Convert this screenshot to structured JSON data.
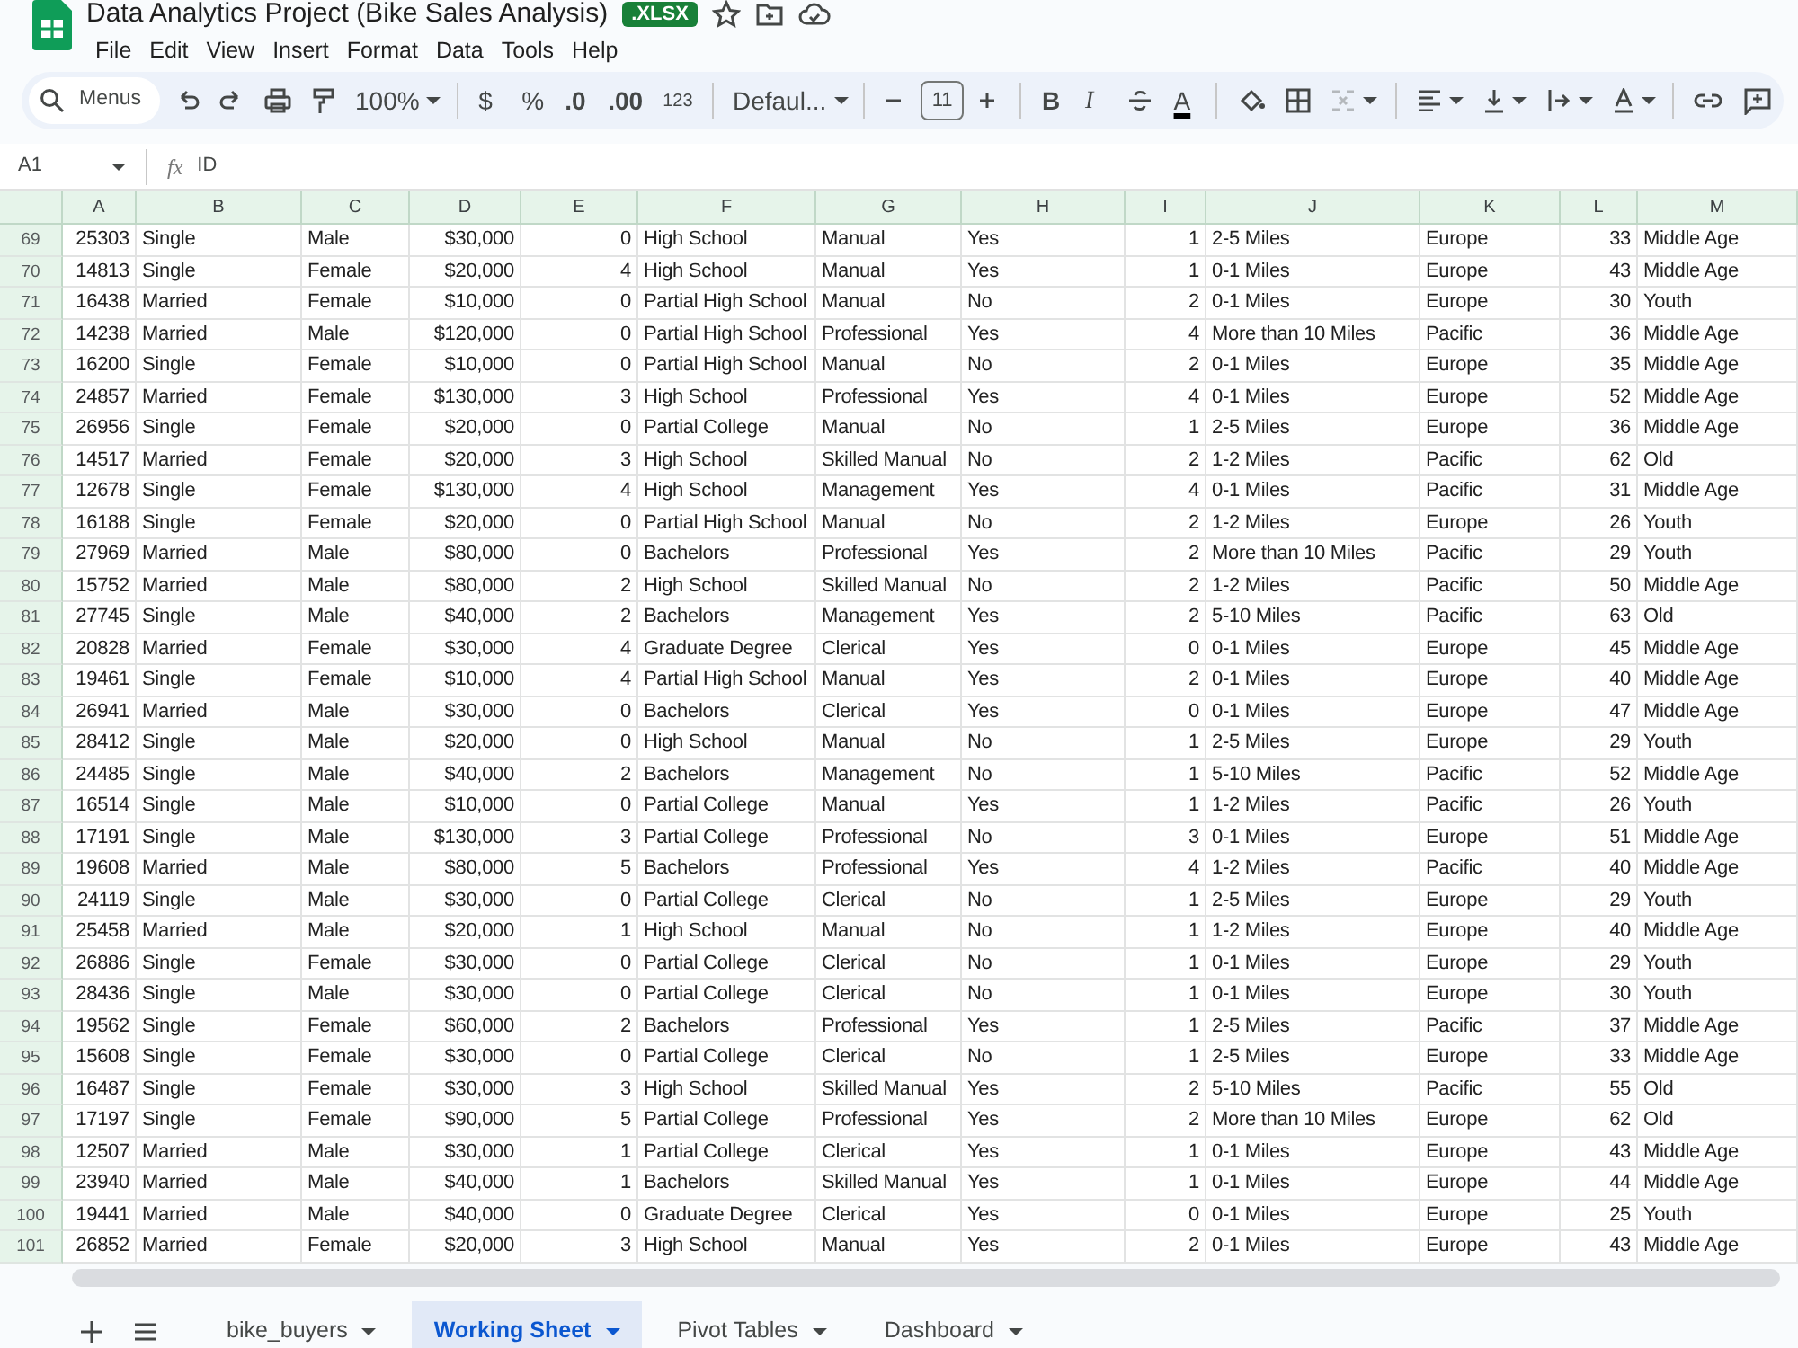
{
  "app": {
    "title": "Data Analytics Project (Bike Sales Analysis)",
    "badge": ".XLSX",
    "menu": [
      "File",
      "Edit",
      "View",
      "Insert",
      "Format",
      "Data",
      "Tools",
      "Help"
    ]
  },
  "toolbar": {
    "search_placeholder": "Menus",
    "zoom": "100%",
    "currency": "$",
    "percent": "%",
    "decimal_decrease": ".0",
    "decimal_increase": ".00",
    "number_format": "123",
    "font": "Defaul...",
    "font_size": "11",
    "bold": "B",
    "italic": "I",
    "text_color": "A"
  },
  "formula_bar": {
    "cell": "A1",
    "fx": "fx",
    "value": "ID"
  },
  "columns": [
    {
      "label": "A",
      "kind": "number"
    },
    {
      "label": "B",
      "kind": "text"
    },
    {
      "label": "C",
      "kind": "text"
    },
    {
      "label": "D",
      "kind": "number"
    },
    {
      "label": "E",
      "kind": "number"
    },
    {
      "label": "F",
      "kind": "text"
    },
    {
      "label": "G",
      "kind": "text"
    },
    {
      "label": "H",
      "kind": "text"
    },
    {
      "label": "I",
      "kind": "number"
    },
    {
      "label": "J",
      "kind": "text"
    },
    {
      "label": "K",
      "kind": "text"
    },
    {
      "label": "L",
      "kind": "number"
    },
    {
      "label": "M",
      "kind": "text"
    }
  ],
  "rows": [
    {
      "n": "69",
      "cells": [
        "25303",
        "Single",
        "Male",
        "$30,000",
        "0",
        "High School",
        "Manual",
        "Yes",
        "1",
        "2-5 Miles",
        "Europe",
        "33",
        "Middle Age"
      ]
    },
    {
      "n": "70",
      "cells": [
        "14813",
        "Single",
        "Female",
        "$20,000",
        "4",
        "High School",
        "Manual",
        "Yes",
        "1",
        "0-1 Miles",
        "Europe",
        "43",
        "Middle Age"
      ]
    },
    {
      "n": "71",
      "cells": [
        "16438",
        "Married",
        "Female",
        "$10,000",
        "0",
        "Partial High School",
        "Manual",
        "No",
        "2",
        "0-1 Miles",
        "Europe",
        "30",
        "Youth"
      ]
    },
    {
      "n": "72",
      "cells": [
        "14238",
        "Married",
        "Male",
        "$120,000",
        "0",
        "Partial High School",
        "Professional",
        "Yes",
        "4",
        "More than 10 Miles",
        "Pacific",
        "36",
        "Middle Age"
      ]
    },
    {
      "n": "73",
      "cells": [
        "16200",
        "Single",
        "Female",
        "$10,000",
        "0",
        "Partial High School",
        "Manual",
        "No",
        "2",
        "0-1 Miles",
        "Europe",
        "35",
        "Middle Age"
      ]
    },
    {
      "n": "74",
      "cells": [
        "24857",
        "Married",
        "Female",
        "$130,000",
        "3",
        "High School",
        "Professional",
        "Yes",
        "4",
        "0-1 Miles",
        "Europe",
        "52",
        "Middle Age"
      ]
    },
    {
      "n": "75",
      "cells": [
        "26956",
        "Single",
        "Female",
        "$20,000",
        "0",
        "Partial College",
        "Manual",
        "No",
        "1",
        "2-5 Miles",
        "Europe",
        "36",
        "Middle Age"
      ]
    },
    {
      "n": "76",
      "cells": [
        "14517",
        "Married",
        "Female",
        "$20,000",
        "3",
        "High School",
        "Skilled Manual",
        "No",
        "2",
        "1-2 Miles",
        "Pacific",
        "62",
        "Old"
      ]
    },
    {
      "n": "77",
      "cells": [
        "12678",
        "Single",
        "Female",
        "$130,000",
        "4",
        "High School",
        "Management",
        "Yes",
        "4",
        "0-1 Miles",
        "Pacific",
        "31",
        "Middle Age"
      ]
    },
    {
      "n": "78",
      "cells": [
        "16188",
        "Single",
        "Female",
        "$20,000",
        "0",
        "Partial High School",
        "Manual",
        "No",
        "2",
        "1-2 Miles",
        "Europe",
        "26",
        "Youth"
      ]
    },
    {
      "n": "79",
      "cells": [
        "27969",
        "Married",
        "Male",
        "$80,000",
        "0",
        "Bachelors",
        "Professional",
        "Yes",
        "2",
        "More than 10 Miles",
        "Pacific",
        "29",
        "Youth"
      ]
    },
    {
      "n": "80",
      "cells": [
        "15752",
        "Married",
        "Male",
        "$80,000",
        "2",
        "High School",
        "Skilled Manual",
        "No",
        "2",
        "1-2 Miles",
        "Pacific",
        "50",
        "Middle Age"
      ]
    },
    {
      "n": "81",
      "cells": [
        "27745",
        "Single",
        "Male",
        "$40,000",
        "2",
        "Bachelors",
        "Management",
        "Yes",
        "2",
        "5-10 Miles",
        "Pacific",
        "63",
        "Old"
      ]
    },
    {
      "n": "82",
      "cells": [
        "20828",
        "Married",
        "Female",
        "$30,000",
        "4",
        "Graduate Degree",
        "Clerical",
        "Yes",
        "0",
        "0-1 Miles",
        "Europe",
        "45",
        "Middle Age"
      ]
    },
    {
      "n": "83",
      "cells": [
        "19461",
        "Single",
        "Female",
        "$10,000",
        "4",
        "Partial High School",
        "Manual",
        "Yes",
        "2",
        "0-1 Miles",
        "Europe",
        "40",
        "Middle Age"
      ]
    },
    {
      "n": "84",
      "cells": [
        "26941",
        "Married",
        "Male",
        "$30,000",
        "0",
        "Bachelors",
        "Clerical",
        "Yes",
        "0",
        "0-1 Miles",
        "Europe",
        "47",
        "Middle Age"
      ]
    },
    {
      "n": "85",
      "cells": [
        "28412",
        "Single",
        "Male",
        "$20,000",
        "0",
        "High School",
        "Manual",
        "No",
        "1",
        "2-5 Miles",
        "Europe",
        "29",
        "Youth"
      ]
    },
    {
      "n": "86",
      "cells": [
        "24485",
        "Single",
        "Male",
        "$40,000",
        "2",
        "Bachelors",
        "Management",
        "No",
        "1",
        "5-10 Miles",
        "Pacific",
        "52",
        "Middle Age"
      ]
    },
    {
      "n": "87",
      "cells": [
        "16514",
        "Single",
        "Male",
        "$10,000",
        "0",
        "Partial College",
        "Manual",
        "Yes",
        "1",
        "1-2 Miles",
        "Pacific",
        "26",
        "Youth"
      ]
    },
    {
      "n": "88",
      "cells": [
        "17191",
        "Single",
        "Male",
        "$130,000",
        "3",
        "Partial College",
        "Professional",
        "No",
        "3",
        "0-1 Miles",
        "Europe",
        "51",
        "Middle Age"
      ]
    },
    {
      "n": "89",
      "cells": [
        "19608",
        "Married",
        "Male",
        "$80,000",
        "5",
        "Bachelors",
        "Professional",
        "Yes",
        "4",
        "1-2 Miles",
        "Pacific",
        "40",
        "Middle Age"
      ]
    },
    {
      "n": "90",
      "cells": [
        "24119",
        "Single",
        "Male",
        "$30,000",
        "0",
        "Partial College",
        "Clerical",
        "No",
        "1",
        "2-5 Miles",
        "Europe",
        "29",
        "Youth"
      ]
    },
    {
      "n": "91",
      "cells": [
        "25458",
        "Married",
        "Male",
        "$20,000",
        "1",
        "High School",
        "Manual",
        "No",
        "1",
        "1-2 Miles",
        "Europe",
        "40",
        "Middle Age"
      ]
    },
    {
      "n": "92",
      "cells": [
        "26886",
        "Single",
        "Female",
        "$30,000",
        "0",
        "Partial College",
        "Clerical",
        "No",
        "1",
        "0-1 Miles",
        "Europe",
        "29",
        "Youth"
      ]
    },
    {
      "n": "93",
      "cells": [
        "28436",
        "Single",
        "Male",
        "$30,000",
        "0",
        "Partial College",
        "Clerical",
        "No",
        "1",
        "0-1 Miles",
        "Europe",
        "30",
        "Youth"
      ]
    },
    {
      "n": "94",
      "cells": [
        "19562",
        "Single",
        "Female",
        "$60,000",
        "2",
        "Bachelors",
        "Professional",
        "Yes",
        "1",
        "2-5 Miles",
        "Pacific",
        "37",
        "Middle Age"
      ]
    },
    {
      "n": "95",
      "cells": [
        "15608",
        "Single",
        "Female",
        "$30,000",
        "0",
        "Partial College",
        "Clerical",
        "No",
        "1",
        "2-5 Miles",
        "Europe",
        "33",
        "Middle Age"
      ]
    },
    {
      "n": "96",
      "cells": [
        "16487",
        "Single",
        "Female",
        "$30,000",
        "3",
        "High School",
        "Skilled Manual",
        "Yes",
        "2",
        "5-10 Miles",
        "Pacific",
        "55",
        "Old"
      ]
    },
    {
      "n": "97",
      "cells": [
        "17197",
        "Single",
        "Female",
        "$90,000",
        "5",
        "Partial College",
        "Professional",
        "Yes",
        "2",
        "More than 10 Miles",
        "Europe",
        "62",
        "Old"
      ]
    },
    {
      "n": "98",
      "cells": [
        "12507",
        "Married",
        "Male",
        "$30,000",
        "1",
        "Partial College",
        "Clerical",
        "Yes",
        "1",
        "0-1 Miles",
        "Europe",
        "43",
        "Middle Age"
      ]
    },
    {
      "n": "99",
      "cells": [
        "23940",
        "Married",
        "Male",
        "$40,000",
        "1",
        "Bachelors",
        "Skilled Manual",
        "Yes",
        "1",
        "0-1 Miles",
        "Europe",
        "44",
        "Middle Age"
      ]
    },
    {
      "n": "100",
      "cells": [
        "19441",
        "Married",
        "Male",
        "$40,000",
        "0",
        "Graduate Degree",
        "Clerical",
        "Yes",
        "0",
        "0-1 Miles",
        "Europe",
        "25",
        "Youth"
      ]
    },
    {
      "n": "101",
      "cells": [
        "26852",
        "Married",
        "Female",
        "$20,000",
        "3",
        "High School",
        "Manual",
        "Yes",
        "2",
        "0-1 Miles",
        "Europe",
        "43",
        "Middle Age"
      ]
    }
  ],
  "sheets": [
    {
      "label": "bike_buyers",
      "selected": false
    },
    {
      "label": "Working Sheet",
      "selected": true
    },
    {
      "label": "Pivot Tables",
      "selected": false
    },
    {
      "label": "Dashboard",
      "selected": false
    }
  ]
}
